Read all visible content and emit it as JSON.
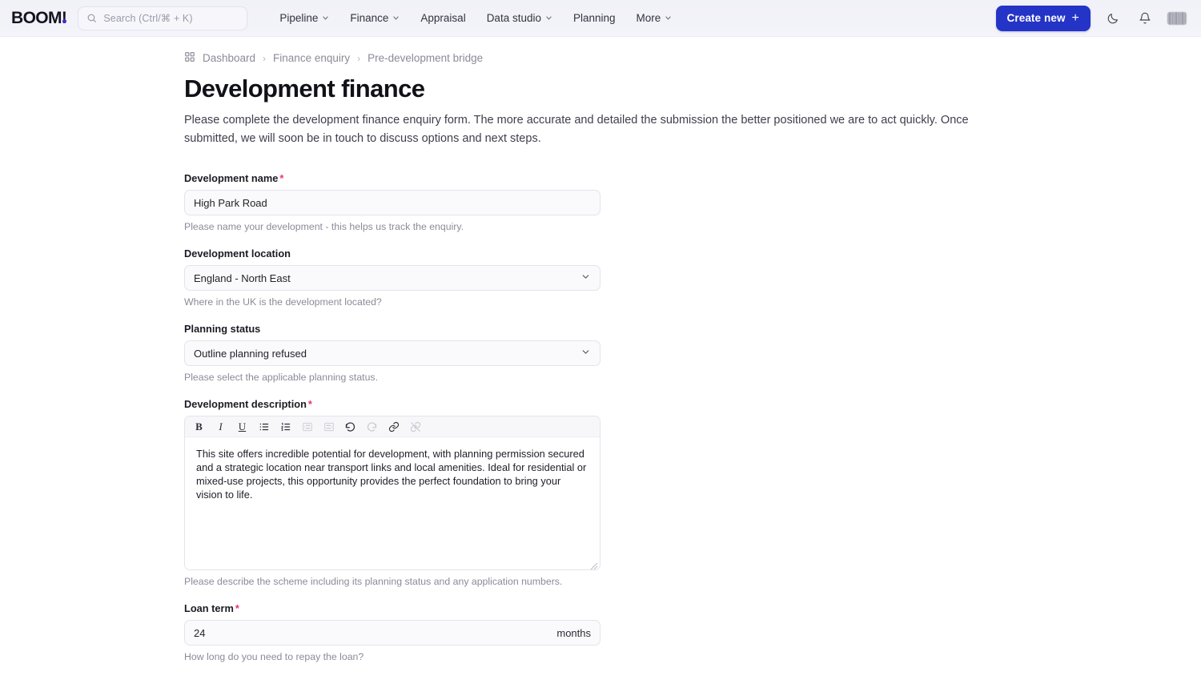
{
  "navbar": {
    "logo": "BOOM!",
    "search": {
      "placeholder": "Search (Ctrl/⌘ + K)"
    },
    "links": [
      {
        "label": "Pipeline",
        "has_chevron": true
      },
      {
        "label": "Finance",
        "has_chevron": true
      },
      {
        "label": "Appraisal",
        "has_chevron": false
      },
      {
        "label": "Data studio",
        "has_chevron": true
      },
      {
        "label": "Planning",
        "has_chevron": false
      },
      {
        "label": "More",
        "has_chevron": true
      }
    ],
    "create_button": "Create new",
    "create_button_icon": "plus-icon",
    "theme_toggle_icon": "moon-icon",
    "notifications_icon": "bell-icon",
    "avatar_icon": "user-avatar",
    "accent_color": "#2434c6"
  },
  "breadcrumb": {
    "home_icon": "grid-icon",
    "items": [
      "Dashboard",
      "Finance enquiry",
      "Pre-development bridge"
    ],
    "separator": "›"
  },
  "page": {
    "title": "Development finance",
    "description": "Please complete the development finance enquiry form. The more accurate and detailed the submission the better positioned we are to act quickly. Once submitted, we will soon be in touch to discuss options and next steps."
  },
  "form": {
    "development_name": {
      "label": "Development name",
      "required": true,
      "value": "High Park Road",
      "placeholder": "Development name",
      "hint": "Please name your development - this helps us track the enquiry."
    },
    "development_location": {
      "label": "Development location",
      "required": false,
      "value": "England - North East",
      "hint": "Where in the UK is the development located?",
      "chevron_icon": "chevron-down-icon"
    },
    "planning_status": {
      "label": "Planning status",
      "required": false,
      "value": "Outline planning refused",
      "hint": "Please select the applicable planning status.",
      "chevron_icon": "chevron-down-icon"
    },
    "development_description": {
      "label": "Development description",
      "required": true,
      "value": "This site offers incredible potential for development, with planning permission secured and a strategic location near transport links and local amenities. Ideal for residential or mixed-use projects, this opportunity provides the perfect foundation to bring your vision to life.",
      "hint": "Please describe the scheme including its planning status and any application numbers.",
      "toolbar": [
        {
          "name": "bold",
          "label": "B",
          "disabled": false
        },
        {
          "name": "italic",
          "label": "I",
          "disabled": false
        },
        {
          "name": "underline",
          "label": "U",
          "disabled": false
        },
        {
          "name": "bullet-list",
          "label": "",
          "disabled": false
        },
        {
          "name": "numbered-list",
          "label": "",
          "disabled": false
        },
        {
          "name": "outdent",
          "label": "",
          "disabled": true
        },
        {
          "name": "indent",
          "label": "",
          "disabled": true
        },
        {
          "name": "undo",
          "label": "",
          "disabled": false
        },
        {
          "name": "redo",
          "label": "",
          "disabled": true
        },
        {
          "name": "link",
          "label": "",
          "disabled": false
        },
        {
          "name": "unlink",
          "label": "",
          "disabled": true
        }
      ]
    },
    "loan_term": {
      "label": "Loan term",
      "required": true,
      "value": "24",
      "suffix": "months",
      "hint": "How long do you need to repay the loan?"
    }
  }
}
